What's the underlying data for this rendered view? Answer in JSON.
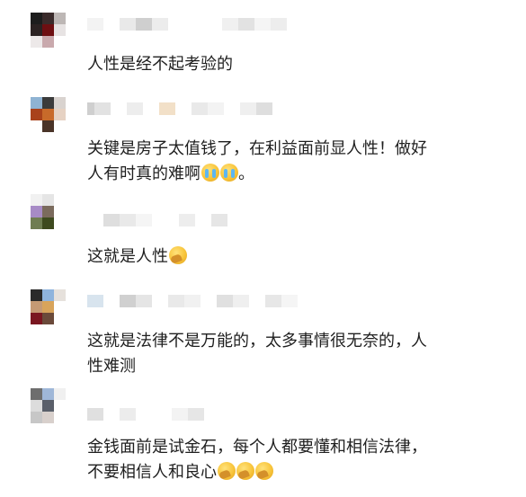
{
  "comments": [
    {
      "text": "人性是经不起考验的",
      "emojis": []
    },
    {
      "text": "关键是房子太值钱了，在利益面前显人性！做好\n人有时真的难啊",
      "emojis": [
        "crying-face-icon",
        "crying-face-icon"
      ],
      "suffix": "。"
    },
    {
      "text": "这就是人性",
      "emojis": [
        "facepalm-icon"
      ]
    },
    {
      "text": "这就是法律不是万能的，太多事情很无奈的，人\n性难测",
      "emojis": []
    },
    {
      "text": "金钱面前是试金石，每个人都要懂和相信法律，\n不要相信人和良心",
      "emojis": [
        "facepalm-icon",
        "facepalm-icon",
        "facepalm-icon"
      ]
    }
  ],
  "colors": {
    "text": "#1f1f1f",
    "background": "#ffffff"
  }
}
